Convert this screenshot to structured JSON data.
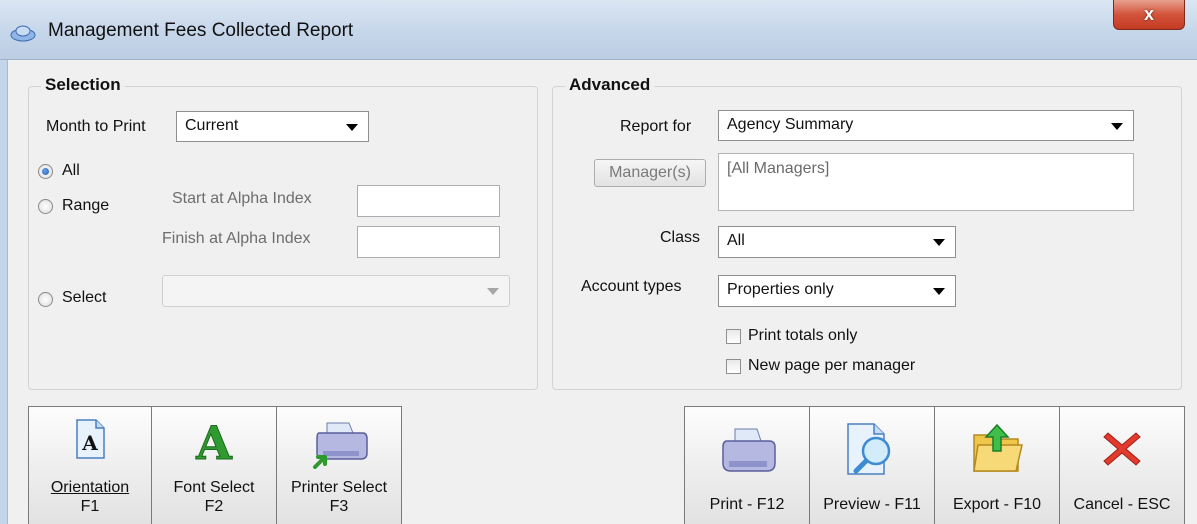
{
  "window": {
    "title": "Management Fees Collected Report",
    "close_label": "x"
  },
  "selection": {
    "group_title": "Selection",
    "month_label": "Month to Print",
    "month_value": "Current",
    "radio_all": "All",
    "radio_range": "Range",
    "radio_select": "Select",
    "start_label": "Start at Alpha Index",
    "finish_label": "Finish at Alpha Index",
    "start_value": "",
    "finish_value": "",
    "select_value": ""
  },
  "advanced": {
    "group_title": "Advanced",
    "report_for_label": "Report for",
    "report_for_value": "Agency Summary",
    "managers_button": "Manager(s)",
    "managers_value": "[All Managers]",
    "class_label": "Class",
    "class_value": "All",
    "account_types_label": "Account types",
    "account_types_value": "Properties only",
    "print_totals_label": "Print totals only",
    "new_page_label": "New page per manager"
  },
  "toolbar_left": [
    {
      "line1": "Orientation",
      "line2": "F1",
      "icon": "orientation-icon"
    },
    {
      "line1": "Font Select",
      "line2": "F2",
      "icon": "font-icon"
    },
    {
      "line1": "Printer Select",
      "line2": "F3",
      "icon": "printer-select-icon"
    }
  ],
  "toolbar_right": [
    {
      "label": "Print - F12",
      "icon": "printer-icon"
    },
    {
      "label": "Preview - F11",
      "icon": "preview-icon"
    },
    {
      "label": "Export - F10",
      "icon": "export-folder-icon"
    },
    {
      "label": "Cancel - ESC",
      "icon": "cancel-x-icon"
    }
  ]
}
